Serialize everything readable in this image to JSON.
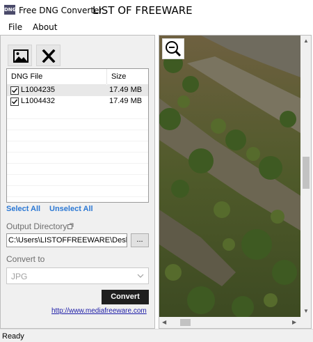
{
  "window": {
    "app_icon_text": "DNG",
    "title": "Free DNG Converter",
    "watermark": "LIST OF FREEWARE"
  },
  "menu": [
    "File",
    "About"
  ],
  "toolbar": {
    "add_icon": "image-icon",
    "remove_icon": "close-icon"
  },
  "table": {
    "columns": [
      "DNG File",
      "Size"
    ],
    "rows": [
      {
        "checked": true,
        "name": "L1004235",
        "size": "17.49 MB"
      },
      {
        "checked": true,
        "name": "L1004432",
        "size": "17.49 MB"
      }
    ]
  },
  "selection": {
    "select_all": "Select All",
    "unselect_all": "Unselect All"
  },
  "output": {
    "label": "Output Directory",
    "value": "C:\\Users\\LISTOFFREEWARE\\Deskto",
    "browse_label": "..."
  },
  "convert_to": {
    "label": "Convert to",
    "selected": "JPG"
  },
  "actions": {
    "convert_label": "Convert",
    "url": "http://www.mediafreeware.com"
  },
  "preview": {
    "zoom_icon": "zoom-out-icon"
  },
  "status": {
    "text": "Ready"
  },
  "colors": {
    "link": "#2b78d4",
    "convert_bg": "#1f1f1f",
    "url": "#1a1aa6"
  }
}
